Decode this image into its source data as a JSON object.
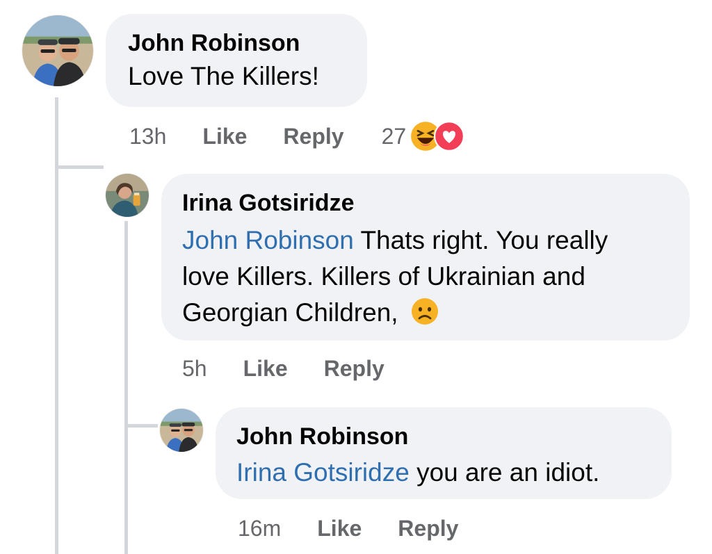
{
  "comments": [
    {
      "author": "John Robinson",
      "text": "Love The Killers!",
      "time": "13h",
      "like_label": "Like",
      "reply_label": "Reply",
      "reaction_count": "27",
      "reactions": [
        "haha-icon",
        "love-icon"
      ]
    },
    {
      "author": "Irina Gotsiridze",
      "mention": "John Robinson",
      "text_line1": " Thats right. You really",
      "text_line2": "love Killers. Killers of Ukrainian and",
      "text_line3": "Georgian Children, ",
      "emoji": "worried-face-icon",
      "time": "5h",
      "like_label": "Like",
      "reply_label": "Reply"
    },
    {
      "author": "John Robinson",
      "mention": "Irina Gotsiridze",
      "text": " you are an idiot.",
      "time": "16m",
      "like_label": "Like",
      "reply_label": "Reply"
    }
  ],
  "colors": {
    "bubble": "#f0f2f5",
    "mention": "#2f6fb0",
    "meta": "#65676b",
    "thread_line": "#d3d6db",
    "haha": "#f7b125",
    "love": "#f33e58"
  }
}
